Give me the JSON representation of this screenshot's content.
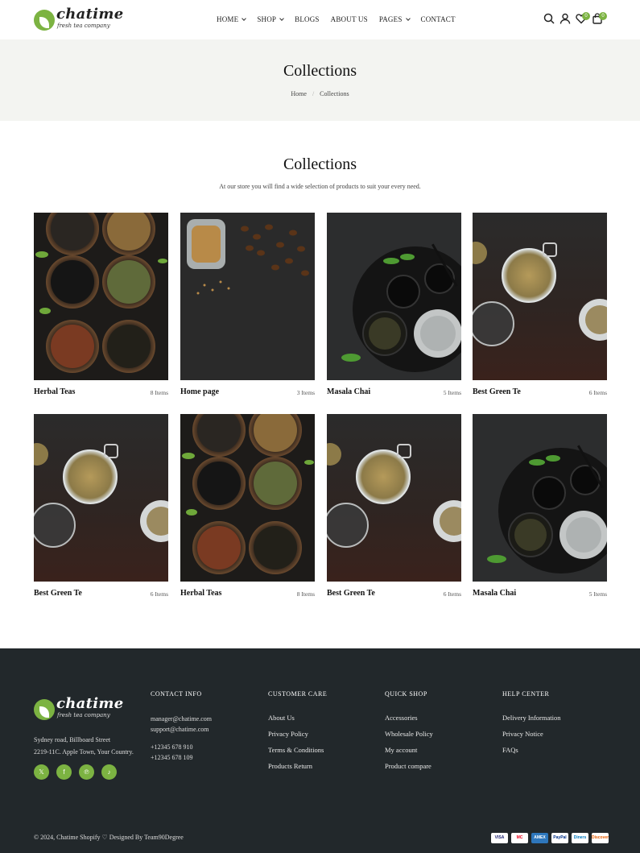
{
  "header": {
    "brand": "chatime",
    "tagline": "fresh tea company",
    "nav": [
      {
        "label": "HOME",
        "dropdown": true
      },
      {
        "label": "SHOP",
        "dropdown": true
      },
      {
        "label": "BLOGS",
        "dropdown": false
      },
      {
        "label": "ABOUT US",
        "dropdown": false
      },
      {
        "label": "PAGES",
        "dropdown": true
      },
      {
        "label": "CONTACT",
        "dropdown": false
      }
    ],
    "wishlist_count": "0",
    "cart_count": "0",
    "accent": "#7cb342"
  },
  "banner": {
    "title": "Collections",
    "breadcrumb": [
      "Home",
      "Collections"
    ]
  },
  "section": {
    "title": "Collections",
    "subtitle": "At our store you will find a wide selection of products to suit your every need."
  },
  "collections": [
    {
      "name": "Herbal Teas",
      "items": "8 Items",
      "image": "bowls"
    },
    {
      "name": "Home page",
      "items": "3 Items",
      "image": "beans"
    },
    {
      "name": "Masala Chai",
      "items": "5 Items",
      "image": "teapot"
    },
    {
      "name": "Best Green Te",
      "items": "6 Items",
      "image": "jars"
    },
    {
      "name": "Best Green Te",
      "items": "6 Items",
      "image": "jars"
    },
    {
      "name": "Herbal Teas",
      "items": "8 Items",
      "image": "bowls"
    },
    {
      "name": "Best Green Te",
      "items": "6 Items",
      "image": "jars"
    },
    {
      "name": "Masala Chai",
      "items": "5 Items",
      "image": "teapot"
    }
  ],
  "footer": {
    "brand": "chatime",
    "tagline": "fresh tea company",
    "address_line1": "Sydney road, Billboard Street",
    "address_line2": "2219-11C. Apple Town, Your Country.",
    "social": [
      "x-icon",
      "facebook-icon",
      "pinterest-icon",
      "tiktok-icon"
    ],
    "contact": {
      "heading": "CONTACT INFO",
      "email1": "manager@chatime.com",
      "email2": "support@chatime.com",
      "phone1": "+12345 678 910",
      "phone2": "+12345 678 109"
    },
    "customer_care": {
      "heading": "CUSTOMER CARE",
      "links": [
        "About Us",
        "Privacy Policy",
        "Terms & Conditions",
        "Products Return"
      ]
    },
    "quick_shop": {
      "heading": "QUICK SHOP",
      "links": [
        "Accessories",
        "Wholesale Policy",
        "My account",
        "Product compare"
      ]
    },
    "help_center": {
      "heading": "HELP CENTER",
      "links": [
        "Delivery Information",
        "Privacy Notice",
        "FAQs"
      ]
    },
    "copyright": "© 2024, Chatime Shopify ♡ Designed By Team90Degree",
    "payments": [
      "VISA",
      "MC",
      "AMEX",
      "PayPal",
      "Diners",
      "Discover"
    ]
  }
}
